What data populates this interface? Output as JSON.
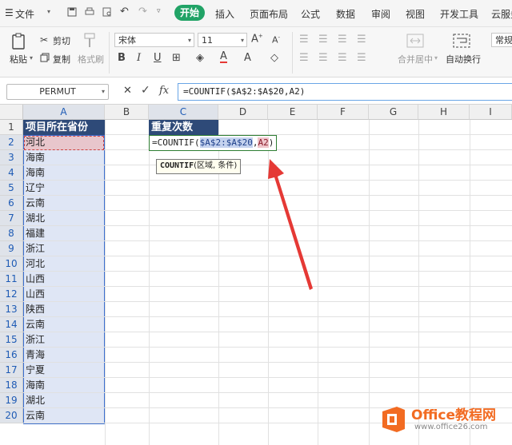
{
  "menu": {
    "file": "文件",
    "tabs": [
      "开始",
      "插入",
      "页面布局",
      "公式",
      "数据",
      "审阅",
      "视图",
      "开发工具",
      "云服务"
    ]
  },
  "ribbon": {
    "paste": "粘贴",
    "cut": "剪切",
    "copy": "复制",
    "format_painter": "格式刷",
    "font_name": "宋体",
    "font_size": "11",
    "merge_center": "合并居中",
    "wrap_text": "自动换行",
    "normal": "常规"
  },
  "formula_bar": {
    "name_box": "PERMUT",
    "cancel": "✕",
    "confirm": "✓",
    "fx": "fx",
    "formula": "=COUNTIF($A$2:$A$20,A2)"
  },
  "sheet": {
    "columns": [
      "A",
      "B",
      "C",
      "D",
      "E",
      "F",
      "G",
      "H",
      "I"
    ],
    "rows": [
      "1",
      "2",
      "3",
      "4",
      "5",
      "6",
      "7",
      "8",
      "9",
      "10",
      "11",
      "12",
      "13",
      "14",
      "15",
      "16",
      "17",
      "18",
      "19",
      "20"
    ],
    "a1": "项目所在省份",
    "c1": "重复次数",
    "column_a": [
      "河北",
      "海南",
      "海南",
      "辽宁",
      "云南",
      "湖北",
      "福建",
      "浙江",
      "河北",
      "山西",
      "山西",
      "陕西",
      "云南",
      "浙江",
      "青海",
      "宁夏",
      "海南",
      "湖北",
      "云南"
    ],
    "c2_prefix": "=COUNTIF(",
    "c2_range": "$A$2:$A$20",
    "c2_comma": ",",
    "c2_ref": "A2",
    "c2_suffix": ")",
    "tooltip_fn": "COUNTIF",
    "tooltip_args": "(区域, 条件)"
  },
  "watermark": {
    "brand": "Office教程网",
    "url": "www.office26.com"
  },
  "colors": {
    "accent_green": "#21a366",
    "header_fill": "#2e4a78",
    "selection": "#dfe6f5",
    "arrow": "#e53935",
    "logo_orange": "#f26b22"
  }
}
